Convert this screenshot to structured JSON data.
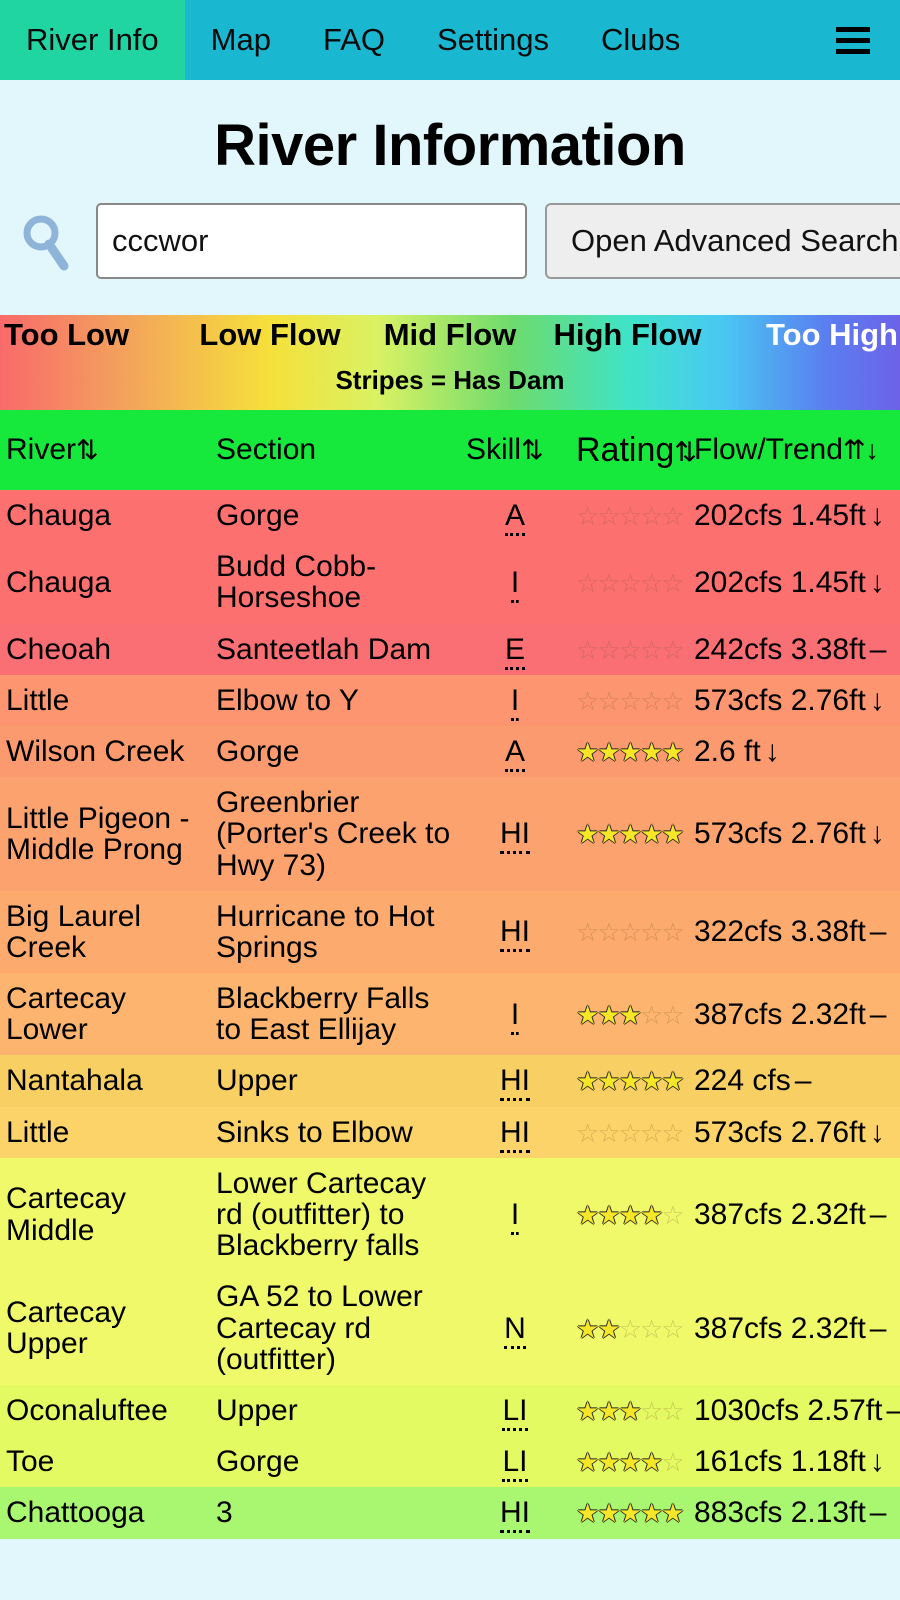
{
  "nav": {
    "items": [
      {
        "label": "River Info",
        "active": true
      },
      {
        "label": "Map",
        "active": false
      },
      {
        "label": "FAQ",
        "active": false
      },
      {
        "label": "Settings",
        "active": false
      },
      {
        "label": "Clubs",
        "active": false
      }
    ],
    "menu_icon": "hamburger-menu-icon"
  },
  "header": {
    "title": "River Information"
  },
  "search": {
    "icon": "magnifying-glass-icon",
    "value": "cccwor",
    "placeholder": "",
    "advanced_button": "Open Advanced Search"
  },
  "legend": {
    "too_low": "Too Low",
    "low_flow": "Low Flow",
    "mid_flow": "Mid Flow",
    "high_flow": "High Flow",
    "too_high": "Too High",
    "note": "Stripes = Has Dam",
    "colors": {
      "too_low": "#f86a6a",
      "low_flow": "#f6e03a",
      "mid_flow": "#6ddb6d",
      "high_flow": "#49c9f2",
      "too_high": "#6c63e8"
    }
  },
  "table": {
    "header_color": "#16e83c",
    "columns": [
      {
        "label": "River",
        "sort": "⇅"
      },
      {
        "label": "Section",
        "sort": ""
      },
      {
        "label": "Skill",
        "sort": "⇅"
      },
      {
        "label": "Rating",
        "sort": "⇅"
      },
      {
        "label": "Flow/Trend",
        "sort": "⇈↓"
      }
    ],
    "rows": [
      {
        "river": "Chauga",
        "section": "Gorge",
        "skill": "A",
        "stars_filled": 0,
        "stars_total": 5,
        "flow": "202cfs 1.45ft",
        "trend": "↓",
        "bg": "#fd7070",
        "striped": false
      },
      {
        "river": "Chauga",
        "section": "Budd Cobb-Horseshoe",
        "skill": "I",
        "stars_filled": 0,
        "stars_total": 5,
        "flow": "202cfs 1.45ft",
        "trend": "↓",
        "bg": "#fd7070",
        "striped": false
      },
      {
        "river": "Cheoah",
        "section": "Santeetlah Dam",
        "skill": "E",
        "stars_filled": 0,
        "stars_total": 5,
        "flow": "242cfs 3.38ft",
        "trend": "–",
        "bg": "#fa6f74",
        "striped": true
      },
      {
        "river": "Little",
        "section": "Elbow to Y",
        "skill": "I",
        "stars_filled": 0,
        "stars_total": 5,
        "flow": "573cfs 2.76ft",
        "trend": "↓",
        "bg": "#fc9570",
        "striped": false
      },
      {
        "river": "Wilson Creek",
        "section": "Gorge",
        "skill": "A",
        "stars_filled": 5,
        "stars_total": 5,
        "flow": "2.6 ft",
        "trend": "↓",
        "bg": "#fb9a6e",
        "striped": false
      },
      {
        "river": "Little Pigeon - Middle Prong",
        "section": "Greenbrier (Porter's Creek to Hwy 73)",
        "skill": "HI",
        "stars_filled": 5,
        "stars_total": 5,
        "flow": "573cfs 2.76ft",
        "trend": "↓",
        "bg": "#fca26f",
        "striped": false
      },
      {
        "river": "Big Laurel Creek",
        "section": "Hurricane to Hot Springs",
        "skill": "HI",
        "stars_filled": 0,
        "stars_total": 5,
        "flow": "322cfs 3.38ft",
        "trend": "–",
        "bg": "#fcaa6e",
        "striped": false
      },
      {
        "river": "Cartecay Lower",
        "section": "Blackberry Falls to East Ellijay",
        "skill": "I",
        "stars_filled": 3,
        "stars_total": 5,
        "flow": "387cfs 2.32ft",
        "trend": "–",
        "bg": "#fdb46e",
        "striped": false
      },
      {
        "river": "Nantahala",
        "section": "Upper",
        "skill": "HI",
        "stars_filled": 5,
        "stars_total": 5,
        "flow": "224 cfs",
        "trend": "–",
        "bg": "#f7cf62",
        "striped": true
      },
      {
        "river": "Little",
        "section": "Sinks to Elbow",
        "skill": "HI",
        "stars_filled": 0,
        "stars_total": 5,
        "flow": "573cfs 2.76ft",
        "trend": "↓",
        "bg": "#fcd368",
        "striped": false
      },
      {
        "river": "Cartecay Middle",
        "section": "Lower Cartecay rd (outfitter) to Blackberry falls",
        "skill": "I",
        "stars_filled": 4,
        "stars_total": 5,
        "flow": "387cfs 2.32ft",
        "trend": "–",
        "bg": "#eff96a",
        "striped": false
      },
      {
        "river": "Cartecay Upper",
        "section": "GA 52 to Lower Cartecay rd (outfitter)",
        "skill": "N",
        "stars_filled": 2,
        "stars_total": 5,
        "flow": "387cfs 2.32ft",
        "trend": "–",
        "bg": "#eff96a",
        "striped": false
      },
      {
        "river": "Oconaluftee",
        "section": "Upper",
        "skill": "LI",
        "stars_filled": 3,
        "stars_total": 5,
        "flow": "1030cfs 2.57ft",
        "trend": "–",
        "bg": "#e4fa63",
        "striped": false
      },
      {
        "river": "Toe",
        "section": "Gorge",
        "skill": "LI",
        "stars_filled": 4,
        "stars_total": 5,
        "flow": "161cfs 1.18ft",
        "trend": "↓",
        "bg": "#e4fa63",
        "striped": false
      },
      {
        "river": "Chattooga",
        "section": "3",
        "skill": "HI",
        "stars_filled": 5,
        "stars_total": 5,
        "flow": "883cfs 2.13ft",
        "trend": "–",
        "bg": "#a9f771",
        "striped": false
      }
    ]
  }
}
